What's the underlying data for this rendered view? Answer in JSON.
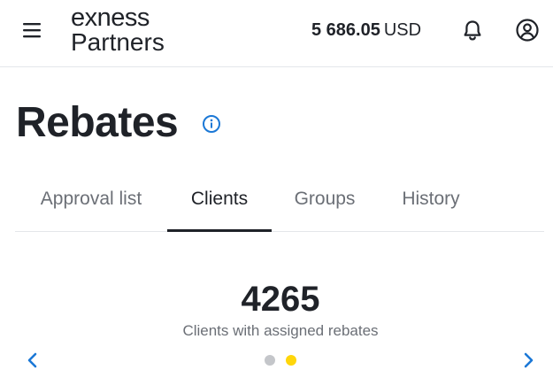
{
  "header": {
    "logo_top": "exness",
    "logo_bottom": "Partners",
    "balance_amount": "5 686.05",
    "balance_currency": "USD"
  },
  "page": {
    "title": "Rebates"
  },
  "tabs": [
    {
      "label": "Approval list",
      "active": false
    },
    {
      "label": "Clients",
      "active": true
    },
    {
      "label": "Groups",
      "active": false
    },
    {
      "label": "History",
      "active": false
    }
  ],
  "stat": {
    "value": "4265",
    "label": "Clients with assigned rebates"
  },
  "carousel": {
    "dots": [
      {
        "active": false,
        "color": "#c4c6ca"
      },
      {
        "active": true,
        "color": "#ffd60a"
      }
    ]
  },
  "colors": {
    "text_primary": "#1f2228",
    "text_secondary": "#6b6f76",
    "accent_blue": "#1b78d6",
    "accent_yellow": "#ffd60a",
    "divider": "#e4e6ea"
  },
  "icons": {
    "menu": "hamburger-menu-icon",
    "bell": "bell-icon",
    "user": "user-circle-icon",
    "info": "info-icon",
    "left": "chevron-left-icon",
    "right": "chevron-right-icon"
  }
}
